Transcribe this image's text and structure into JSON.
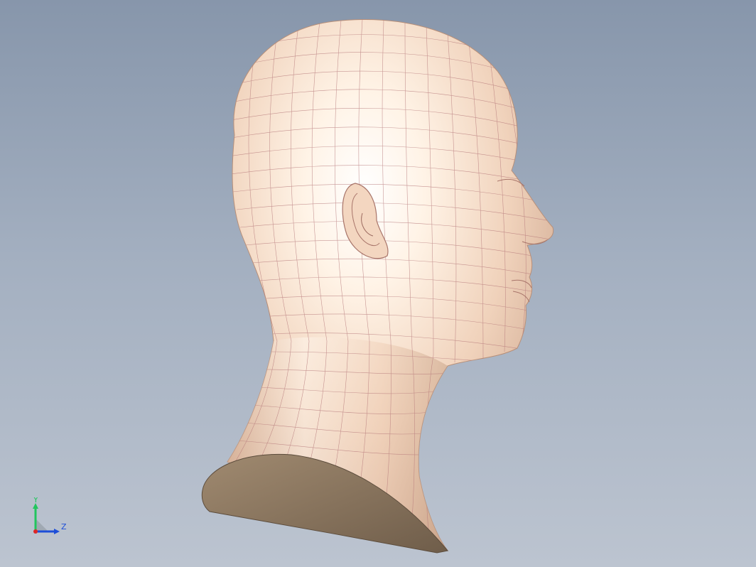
{
  "viewport": {
    "background_top": "#8796ab",
    "background_bottom": "#bcc4d0"
  },
  "model": {
    "surface_color": "#eac8b0",
    "highlight_color": "#ffffff",
    "shadow_color": "#c19a7f",
    "wire_color": "#b5787a",
    "section_face_color": "#8f7a63"
  },
  "triad": {
    "y_label": "Y",
    "z_label": "Z",
    "y_color": "#22c55e",
    "z_color": "#1d4ed8",
    "x_color": "#dc2626"
  }
}
